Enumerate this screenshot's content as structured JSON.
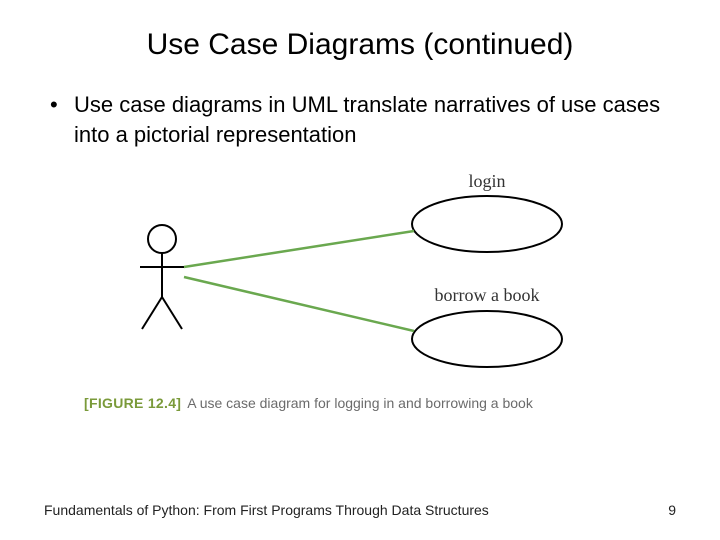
{
  "title": "Use Case Diagrams (continued)",
  "bullet": {
    "text": "Use case diagrams in UML translate narratives of use cases into a pictorial representation"
  },
  "diagram": {
    "usecase1_label": "login",
    "usecase2_label": "borrow a book"
  },
  "figure": {
    "tag": "[FIGURE 12.4]",
    "caption": "A use case diagram for logging in and borrowing a book"
  },
  "footer": {
    "source": "Fundamentals of Python: From First Programs Through Data Structures",
    "page": "9"
  }
}
